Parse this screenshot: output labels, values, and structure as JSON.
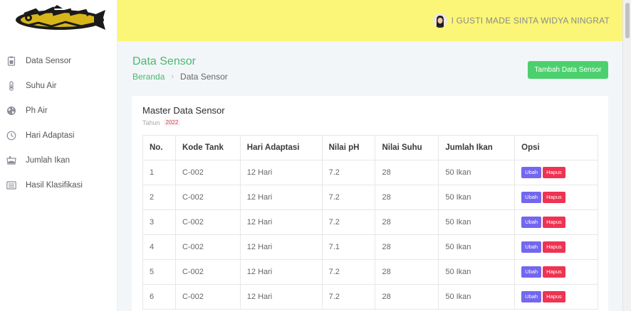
{
  "header": {
    "user_name": "I GUSTI MADE SINTA WIDYA NINGRAT"
  },
  "sidebar": {
    "items": [
      {
        "label": "Data Sensor",
        "icon": "clipboard-icon"
      },
      {
        "label": "Suhu Air",
        "icon": "thermometer-icon"
      },
      {
        "label": "Ph Air",
        "icon": "globe-icon"
      },
      {
        "label": "Hari Adaptasi",
        "icon": "clock-icon"
      },
      {
        "label": "Jumlah Ikan",
        "icon": "fish-tank-icon"
      },
      {
        "label": "Hasil Klasifikasi",
        "icon": "list-icon"
      }
    ]
  },
  "page": {
    "title": "Data Sensor",
    "breadcrumb_home": "Beranda",
    "breadcrumb_sep": "›",
    "breadcrumb_current": "Data Sensor",
    "add_button": "Tambah Data Sensor"
  },
  "card": {
    "title": "Master Data Sensor",
    "year_label": "Tahun",
    "year_value": "2022"
  },
  "table": {
    "headers": [
      "No.",
      "Kode Tank",
      "Hari Adaptasi",
      "Nilai pH",
      "Nilai Suhu",
      "Jumlah Ikan",
      "Opsi"
    ],
    "edit_label": "Ubah",
    "delete_label": "Hapus",
    "rows": [
      [
        "1",
        "C-002",
        "12 Hari",
        "7.2",
        "28",
        "50 Ikan"
      ],
      [
        "2",
        "C-002",
        "12 Hari",
        "7.2",
        "28",
        "50 Ikan"
      ],
      [
        "3",
        "C-002",
        "12 Hari",
        "7.2",
        "28",
        "50 Ikan"
      ],
      [
        "4",
        "C-002",
        "12 Hari",
        "7.1",
        "28",
        "50 Ikan"
      ],
      [
        "5",
        "C-002",
        "12 Hari",
        "7.2",
        "28",
        "50 Ikan"
      ],
      [
        "6",
        "C-002",
        "12 Hari",
        "7.2",
        "28",
        "50 Ikan"
      ]
    ]
  },
  "colors": {
    "header_bg": "#fbf677",
    "accent_green": "#4cb86a",
    "edit_button": "#7367f0",
    "delete_button": "#ef3352"
  }
}
